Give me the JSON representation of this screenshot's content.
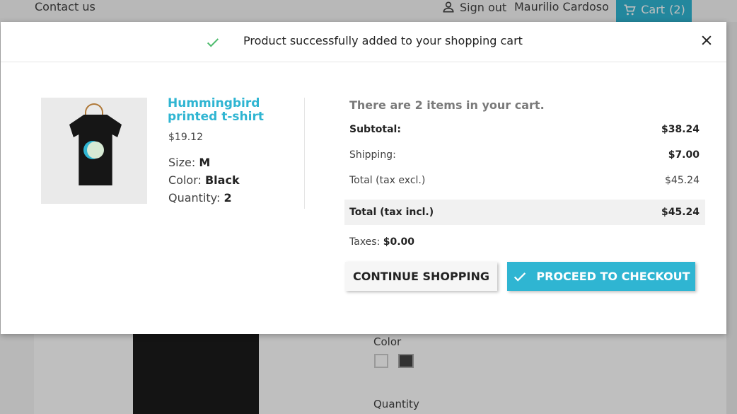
{
  "header": {
    "contact_label": "Contact us",
    "signin_label": "Sign out",
    "user_name": "Maurilio Cardoso",
    "cart_label": "Cart",
    "cart_count": "(2)",
    "icons": {
      "user": "person-icon",
      "cart": "shopping-cart-icon"
    }
  },
  "modal": {
    "title": "Product successfully added to your shopping cart",
    "icons": {
      "success": "check-icon",
      "close": "close-icon"
    },
    "product": {
      "name": "Hummingbird printed t-shirt",
      "price": "$19.12",
      "size_label": "Size:",
      "size_value": "M",
      "color_label": "Color:",
      "color_value": "Black",
      "quantity_label": "Quantity:",
      "quantity_value": "2"
    },
    "cart_summary": {
      "items_text": "There are 2 items in your cart.",
      "subtotal_label": "Subtotal:",
      "subtotal_value": "$38.24",
      "shipping_label": "Shipping:",
      "shipping_value": "$7.00",
      "total_excl_label": "Total (tax excl.)",
      "total_excl_value": "$45.24",
      "total_incl_label": "Total (tax incl.)",
      "total_incl_value": "$45.24",
      "taxes_label": "Taxes:",
      "taxes_value": "$0.00"
    },
    "buttons": {
      "continue": "CONTINUE SHOPPING",
      "checkout": "PROCEED TO CHECKOUT"
    }
  },
  "background": {
    "color_label": "Color",
    "quantity_label": "Quantity"
  },
  "colors": {
    "accent": "#2fb5d2",
    "success": "#4cbb6c"
  }
}
